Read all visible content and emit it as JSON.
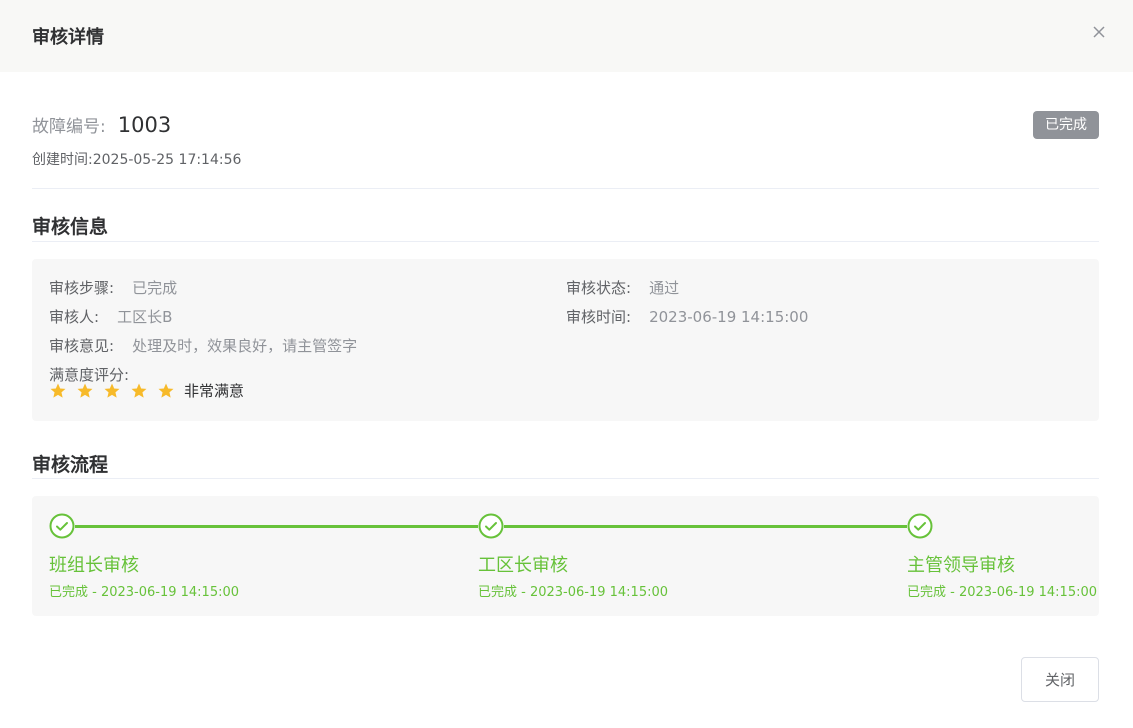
{
  "dialog": {
    "title": "审核详情",
    "close_icon": "close-icon"
  },
  "summary": {
    "fault_label": "故障编号:",
    "fault_no": "1003",
    "created_label": "创建时间:",
    "created_time": "2025-05-25 17:14:56",
    "status": "已完成",
    "status_color": "#909399"
  },
  "audit_info": {
    "title": "审核信息",
    "step_label": "审核步骤:",
    "step_value": "已完成",
    "status_label": "审核状态:",
    "status_value": "通过",
    "auditor_label": "审核人:",
    "auditor_value": "工区长B",
    "time_label": "审核时间:",
    "time_value": "2023-06-19 14:15:00",
    "opinion_label": "审核意见:",
    "opinion_value": "处理及时，效果良好，请主管签字",
    "rating_label": "满意度评分:",
    "rating": 5,
    "rating_max": 5,
    "rating_text": "非常满意",
    "star_color": "#f7ba2a"
  },
  "flow": {
    "title": "审核流程",
    "accent_color": "#67c23a",
    "steps": [
      {
        "name": "班组长审核",
        "desc": "已完成 - 2023-06-19 14:15:00",
        "icon": "check-circle-icon"
      },
      {
        "name": "工区长审核",
        "desc": "已完成 - 2023-06-19 14:15:00",
        "icon": "check-circle-icon"
      },
      {
        "name": "主管领导审核",
        "desc": "已完成 - 2023-06-19 14:15:00",
        "icon": "check-circle-icon"
      }
    ]
  },
  "footer": {
    "close_label": "关闭"
  }
}
